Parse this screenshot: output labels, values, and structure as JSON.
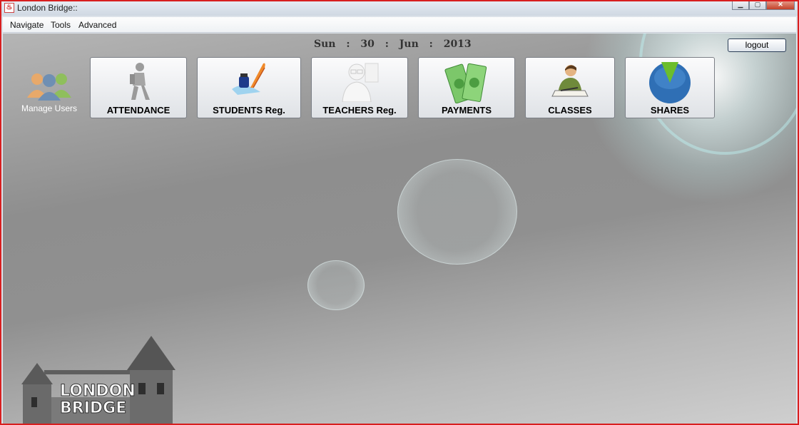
{
  "window": {
    "title": "London Bridge::"
  },
  "menu": [
    {
      "label": "Navigate"
    },
    {
      "label": "Tools"
    },
    {
      "label": "Advanced"
    }
  ],
  "date": {
    "day_name": "Sun",
    "sep": ":",
    "day": "30",
    "month": "Jun",
    "year": "2013"
  },
  "logout_label": "logout",
  "manage_users_label": "Manage Users",
  "tiles": [
    {
      "label": "ATTENDANCE"
    },
    {
      "label": "STUDENTS Reg."
    },
    {
      "label": "TEACHERS Reg."
    },
    {
      "label": "PAYMENTS"
    },
    {
      "label": "CLASSES"
    },
    {
      "label": "SHARES"
    }
  ],
  "logo": {
    "line1": "LONDON",
    "line2": "BRIDGE"
  },
  "colors": {
    "window_border": "#d81f1f",
    "shares_blue": "#2f6fb5",
    "shares_green": "#6bbd2c",
    "money_green": "#7cc76a"
  }
}
